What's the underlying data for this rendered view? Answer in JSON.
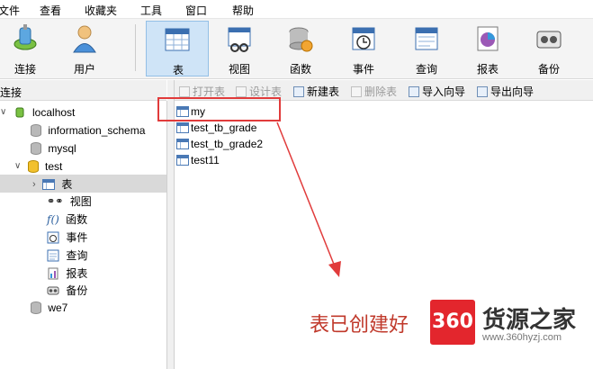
{
  "menu": [
    "文件",
    "查看",
    "收藏夹",
    "工具",
    "窗口",
    "帮助"
  ],
  "toolbar": {
    "connect": "连接",
    "user": "用户",
    "table": "表",
    "view": "视图",
    "function": "函数",
    "event": "事件",
    "query": "查询",
    "report": "报表",
    "backup": "备份",
    "active": "表"
  },
  "sidebar": {
    "header": "连接",
    "connection": "localhost",
    "databases": [
      "information_schema",
      "mysql",
      "test",
      "we7"
    ],
    "test_children": [
      "表",
      "视图",
      "函数",
      "事件",
      "查询",
      "报表",
      "备份"
    ],
    "selected": "表"
  },
  "object_toolbar": {
    "open_table": "打开表",
    "design_table": "设计表",
    "new_table": "新建表",
    "delete_table": "删除表",
    "import_wizard": "导入向导",
    "export_wizard": "导出向导"
  },
  "tables": [
    "my",
    "test_tb_grade",
    "test_tb_grade2",
    "test11"
  ],
  "annotation": "表已创建好",
  "watermark": {
    "logo": "360",
    "brand": "货源之家",
    "url": "www.360hyzj.com"
  },
  "colors": {
    "highlight_box": "#e13b3b",
    "annotation": "#c0392b",
    "selection": "#d9d9d9",
    "active_tool": "#cfe4f7"
  }
}
